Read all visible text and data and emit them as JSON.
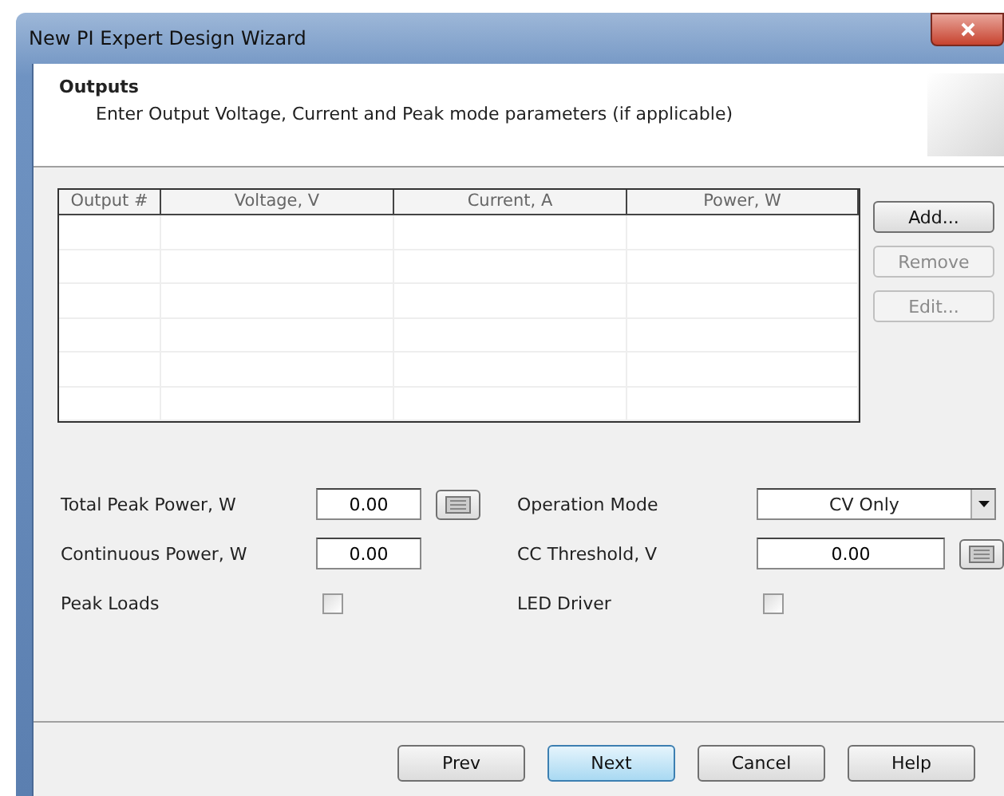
{
  "window": {
    "title": "New PI Expert Design Wizard"
  },
  "header": {
    "title": "Outputs",
    "subtitle": "Enter Output Voltage, Current and Peak mode parameters (if applicable)"
  },
  "table": {
    "columns": [
      "Output #",
      "Voltage, V",
      "Current, A",
      "Power, W"
    ]
  },
  "side_buttons": [
    {
      "label": "Add...",
      "disabled": false
    },
    {
      "label": "Remove",
      "disabled": true
    },
    {
      "label": "Edit...",
      "disabled": true
    }
  ],
  "form_left": [
    {
      "kind": "number",
      "label": "Total Peak Power, W",
      "value": "0.00",
      "calculator": true
    },
    {
      "kind": "number",
      "label": "Continuous Power, W",
      "value": "0.00",
      "calculator": false
    },
    {
      "kind": "checkbox",
      "label": "Peak Loads",
      "checked": false
    }
  ],
  "form_right": [
    {
      "kind": "dropdown",
      "label": "Operation Mode",
      "value": "CV Only"
    },
    {
      "kind": "number",
      "label": "CC Threshold, V",
      "value": "0.00",
      "calculator": true
    },
    {
      "kind": "checkbox",
      "label": "LED Driver",
      "checked": false
    }
  ],
  "footer_buttons": [
    {
      "label": "Prev",
      "default": false
    },
    {
      "label": "Next",
      "default": true
    },
    {
      "label": "Cancel",
      "default": false
    },
    {
      "label": "Help",
      "default": false
    }
  ]
}
